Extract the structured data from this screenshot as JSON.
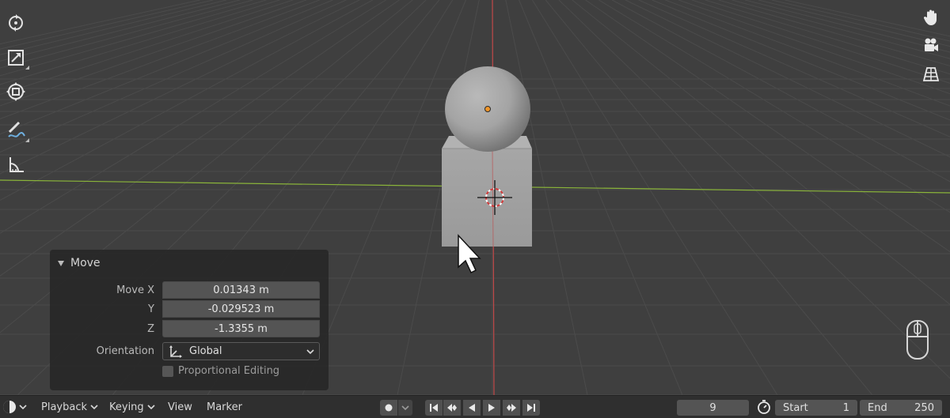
{
  "operator_panel": {
    "title": "Move",
    "move_x_label": "Move X",
    "move_x_value": "0.01343 m",
    "y_label": "Y",
    "y_value": "-0.029523 m",
    "z_label": "Z",
    "z_value": "-1.3355 m",
    "orientation_label": "Orientation",
    "orientation_value": "Global",
    "proportional_label": "Proportional Editing"
  },
  "toolbar": {
    "tools": [
      "rotate-icon",
      "scale-icon",
      "transform-icon",
      "annotate-icon",
      "measure-icon"
    ]
  },
  "navigation": {
    "icons": [
      "hand-pan-icon",
      "camera-icon",
      "grid-perspective-icon",
      "mouse-icon"
    ]
  },
  "timeline": {
    "playback": "Playback",
    "keying": "Keying",
    "view": "View",
    "marker": "Marker",
    "current_frame": "9",
    "start_label": "Start",
    "start_value": "1",
    "end_label": "End",
    "end_value": "250"
  },
  "colors": {
    "x_axis": "#c04848",
    "y_axis": "#8ab43a",
    "origin": "#f0962a",
    "viewport_bg": "#3f3f3f",
    "panel_bg": "#282828"
  }
}
